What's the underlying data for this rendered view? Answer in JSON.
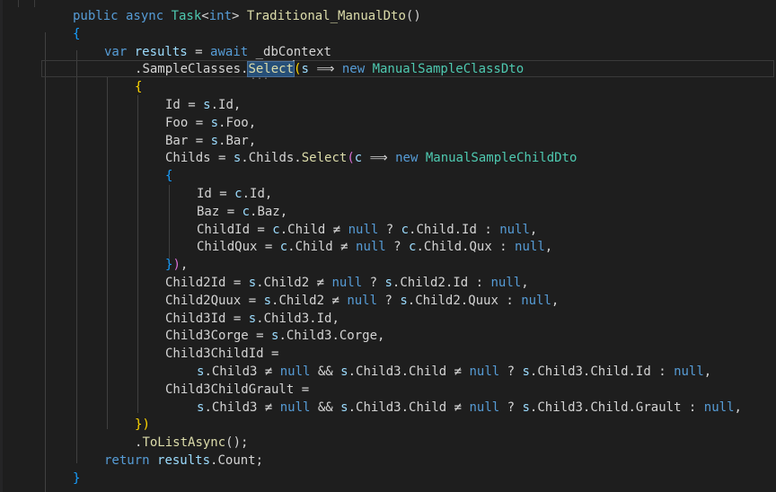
{
  "editor": {
    "lines": [
      [
        [
          "kw",
          "public async "
        ],
        [
          "type",
          "Task"
        ],
        [
          "txt",
          "<"
        ],
        [
          "kw",
          "int"
        ],
        [
          "txt",
          "> "
        ],
        [
          "fn",
          "Traditional_ManualDto"
        ],
        [
          "txt",
          "()"
        ]
      ],
      [
        [
          "br1",
          "{"
        ]
      ],
      [
        [
          "kw",
          "var "
        ],
        [
          "var",
          "results"
        ],
        [
          "txt",
          " = "
        ],
        [
          "kw",
          "await "
        ],
        [
          "txt",
          "_dbContext"
        ]
      ],
      [
        [
          "txt",
          "."
        ],
        [
          "txt",
          "SampleClasses"
        ],
        [
          "txt",
          "."
        ],
        [
          "sel",
          "Select"
        ],
        [
          "caret",
          ""
        ],
        [
          "br2",
          "("
        ],
        [
          "var",
          "s"
        ],
        [
          "txt",
          " ⟹ "
        ],
        [
          "kw",
          "new "
        ],
        [
          "type",
          "ManualSampleClassDto"
        ]
      ],
      [
        [
          "br2",
          "{"
        ]
      ],
      [
        [
          "txt",
          "Id = "
        ],
        [
          "var",
          "s"
        ],
        [
          "txt",
          ".Id,"
        ]
      ],
      [
        [
          "txt",
          "Foo = "
        ],
        [
          "var",
          "s"
        ],
        [
          "txt",
          ".Foo,"
        ]
      ],
      [
        [
          "txt",
          "Bar = "
        ],
        [
          "var",
          "s"
        ],
        [
          "txt",
          ".Bar,"
        ]
      ],
      [
        [
          "txt",
          "Childs = "
        ],
        [
          "var",
          "s"
        ],
        [
          "txt",
          ".Childs."
        ],
        [
          "fn",
          "Select"
        ],
        [
          "br3",
          "("
        ],
        [
          "var",
          "c"
        ],
        [
          "txt",
          " ⟹ "
        ],
        [
          "kw",
          "new "
        ],
        [
          "type",
          "ManualSampleChildDto"
        ]
      ],
      [
        [
          "br1",
          "{"
        ]
      ],
      [
        [
          "txt",
          "Id = "
        ],
        [
          "var",
          "c"
        ],
        [
          "txt",
          ".Id,"
        ]
      ],
      [
        [
          "txt",
          "Baz = "
        ],
        [
          "var",
          "c"
        ],
        [
          "txt",
          ".Baz,"
        ]
      ],
      [
        [
          "txt",
          "ChildId = "
        ],
        [
          "var",
          "c"
        ],
        [
          "txt",
          ".Child ≠ "
        ],
        [
          "null",
          "null"
        ],
        [
          "txt",
          " ? "
        ],
        [
          "var",
          "c"
        ],
        [
          "txt",
          ".Child.Id : "
        ],
        [
          "null",
          "null"
        ],
        [
          "txt",
          ","
        ]
      ],
      [
        [
          "txt",
          "ChildQux = "
        ],
        [
          "var",
          "c"
        ],
        [
          "txt",
          ".Child ≠ "
        ],
        [
          "null",
          "null"
        ],
        [
          "txt",
          " ? "
        ],
        [
          "var",
          "c"
        ],
        [
          "txt",
          ".Child.Qux : "
        ],
        [
          "null",
          "null"
        ],
        [
          "txt",
          ","
        ]
      ],
      [
        [
          "br1",
          "}"
        ],
        [
          "br3",
          ")"
        ],
        [
          "txt",
          ","
        ]
      ],
      [
        [
          "txt",
          "Child2Id = "
        ],
        [
          "var",
          "s"
        ],
        [
          "txt",
          ".Child2 ≠ "
        ],
        [
          "null",
          "null"
        ],
        [
          "txt",
          " ? "
        ],
        [
          "var",
          "s"
        ],
        [
          "txt",
          ".Child2.Id : "
        ],
        [
          "null",
          "null"
        ],
        [
          "txt",
          ","
        ]
      ],
      [
        [
          "txt",
          "Child2Quux = "
        ],
        [
          "var",
          "s"
        ],
        [
          "txt",
          ".Child2 ≠ "
        ],
        [
          "null",
          "null"
        ],
        [
          "txt",
          " ? "
        ],
        [
          "var",
          "s"
        ],
        [
          "txt",
          ".Child2.Quux : "
        ],
        [
          "null",
          "null"
        ],
        [
          "txt",
          ","
        ]
      ],
      [
        [
          "txt",
          "Child3Id = "
        ],
        [
          "var",
          "s"
        ],
        [
          "txt",
          ".Child3.Id,"
        ]
      ],
      [
        [
          "txt",
          "Child3Corge = "
        ],
        [
          "var",
          "s"
        ],
        [
          "txt",
          ".Child3.Corge,"
        ]
      ],
      [
        [
          "txt",
          "Child3ChildId ="
        ]
      ],
      [
        [
          "var",
          "s"
        ],
        [
          "txt",
          ".Child3 ≠ "
        ],
        [
          "null",
          "null"
        ],
        [
          "txt",
          " && "
        ],
        [
          "var",
          "s"
        ],
        [
          "txt",
          ".Child3.Child ≠ "
        ],
        [
          "null",
          "null"
        ],
        [
          "txt",
          " ? "
        ],
        [
          "var",
          "s"
        ],
        [
          "txt",
          ".Child3.Child.Id : "
        ],
        [
          "null",
          "null"
        ],
        [
          "txt",
          ","
        ]
      ],
      [
        [
          "txt",
          "Child3ChildGrault ="
        ]
      ],
      [
        [
          "var",
          "s"
        ],
        [
          "txt",
          ".Child3 ≠ "
        ],
        [
          "null",
          "null"
        ],
        [
          "txt",
          " && "
        ],
        [
          "var",
          "s"
        ],
        [
          "txt",
          ".Child3.Child ≠ "
        ],
        [
          "null",
          "null"
        ],
        [
          "txt",
          " ? "
        ],
        [
          "var",
          "s"
        ],
        [
          "txt",
          ".Child3.Child.Grault : "
        ],
        [
          "null",
          "null"
        ],
        [
          "txt",
          ","
        ]
      ],
      [
        [
          "br2",
          "}"
        ],
        [
          "br2",
          ")"
        ]
      ],
      [
        [
          "txt",
          "."
        ],
        [
          "fn",
          "ToListAsync"
        ],
        [
          "txt",
          "();"
        ]
      ],
      [
        [
          "kw",
          "return "
        ],
        [
          "var",
          "results"
        ],
        [
          "txt",
          ".Count;"
        ]
      ],
      [
        [
          "br1",
          "}"
        ]
      ]
    ],
    "ellipsis": "..."
  }
}
